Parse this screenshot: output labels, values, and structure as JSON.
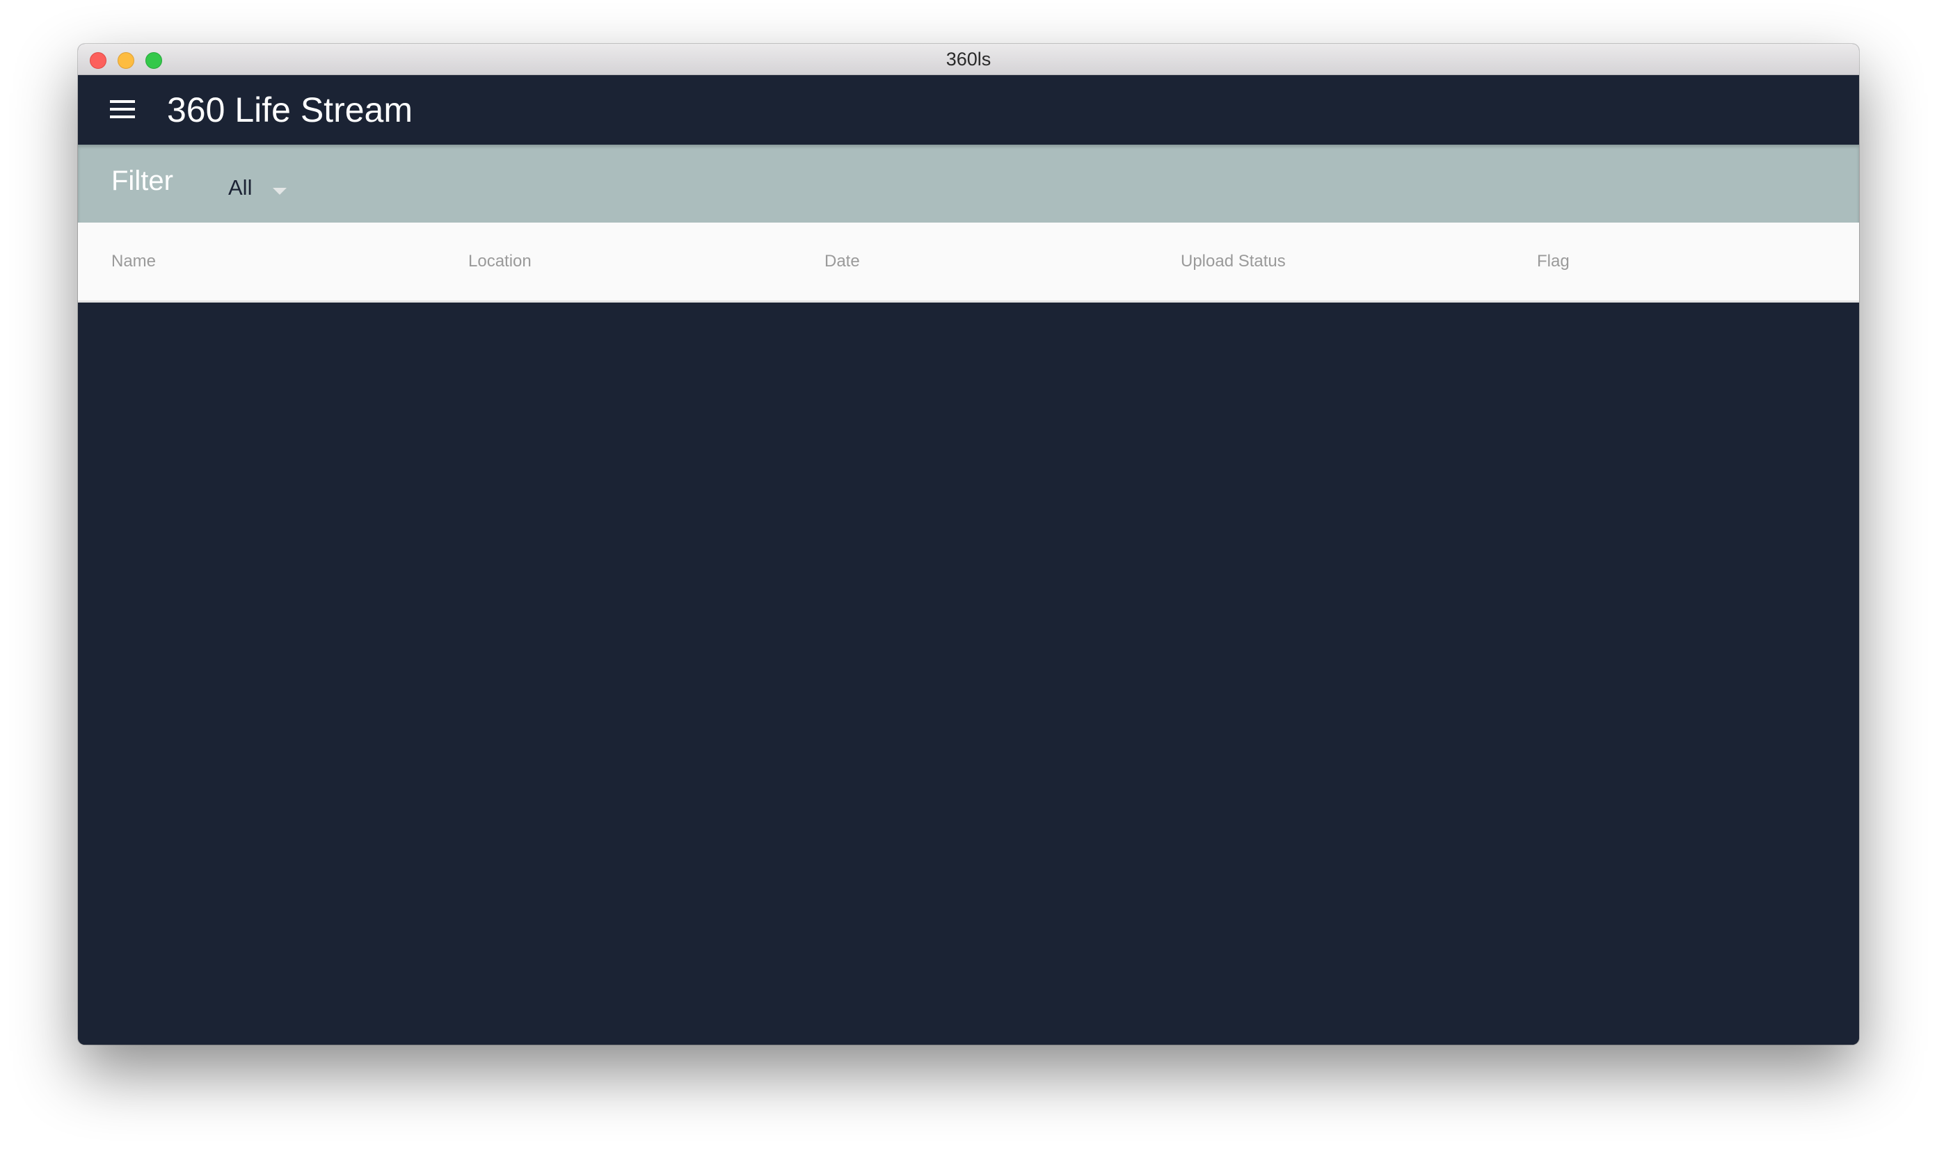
{
  "window": {
    "title": "360ls",
    "controls": [
      "close",
      "minimize",
      "maximize"
    ]
  },
  "appbar": {
    "menu_icon": "hamburger-menu-icon",
    "title": "360 Life Stream"
  },
  "filter": {
    "label": "Filter",
    "selected": "All",
    "dropdown_icon": "caret-down-icon"
  },
  "table": {
    "columns": [
      "Name",
      "Location",
      "Date",
      "Upload Status",
      "Flag"
    ],
    "rows": []
  },
  "colors": {
    "appbar": "#1b2334",
    "filterbar": "#abbdbd",
    "table_header_bg": "#fafafa",
    "column_text": "#9a9a9a"
  }
}
